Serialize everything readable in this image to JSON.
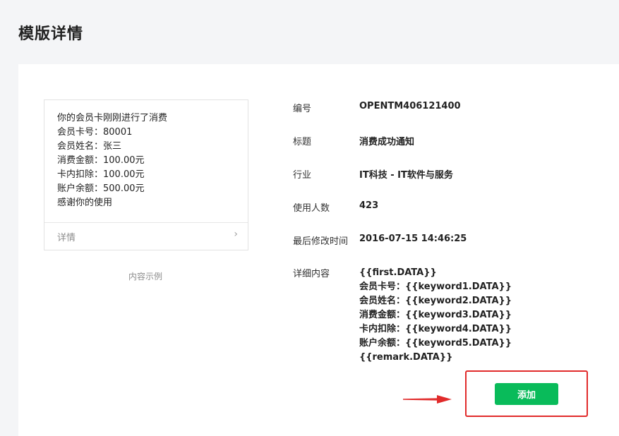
{
  "page": {
    "title": "模版详情"
  },
  "preview": {
    "lines": [
      "你的会员卡刚刚进行了消费",
      "会员卡号：80001",
      "会员姓名：张三",
      "消费金额：100.00元",
      "卡内扣除：100.00元",
      "账户余额：500.00元",
      "感谢你的使用"
    ],
    "detail_label": "详情",
    "caption": "内容示例"
  },
  "info": {
    "number": {
      "label": "编号",
      "value": "OPENTM406121400"
    },
    "title": {
      "label": "标题",
      "value": "消费成功通知"
    },
    "industry": {
      "label": "行业",
      "value": "IT科技 - IT软件与服务"
    },
    "users": {
      "label": "使用人数",
      "value": "423"
    },
    "modified": {
      "label": "最后修改时间",
      "value": "2016-07-15 14:46:25"
    },
    "content": {
      "label": "详细内容",
      "lines": [
        "{{first.DATA}}",
        "会员卡号：{{keyword1.DATA}}",
        "会员姓名：{{keyword2.DATA}}",
        "消费金额：{{keyword3.DATA}}",
        "卡内扣除：{{keyword4.DATA}}",
        "账户余额：{{keyword5.DATA}}",
        "{{remark.DATA}}"
      ]
    }
  },
  "actions": {
    "add_label": "添加"
  },
  "colors": {
    "accent": "#09bb5a",
    "highlight": "#e12b2b"
  },
  "icons": {
    "detail_chevron": "chevron-right-icon",
    "pointer": "arrow-right-icon"
  }
}
